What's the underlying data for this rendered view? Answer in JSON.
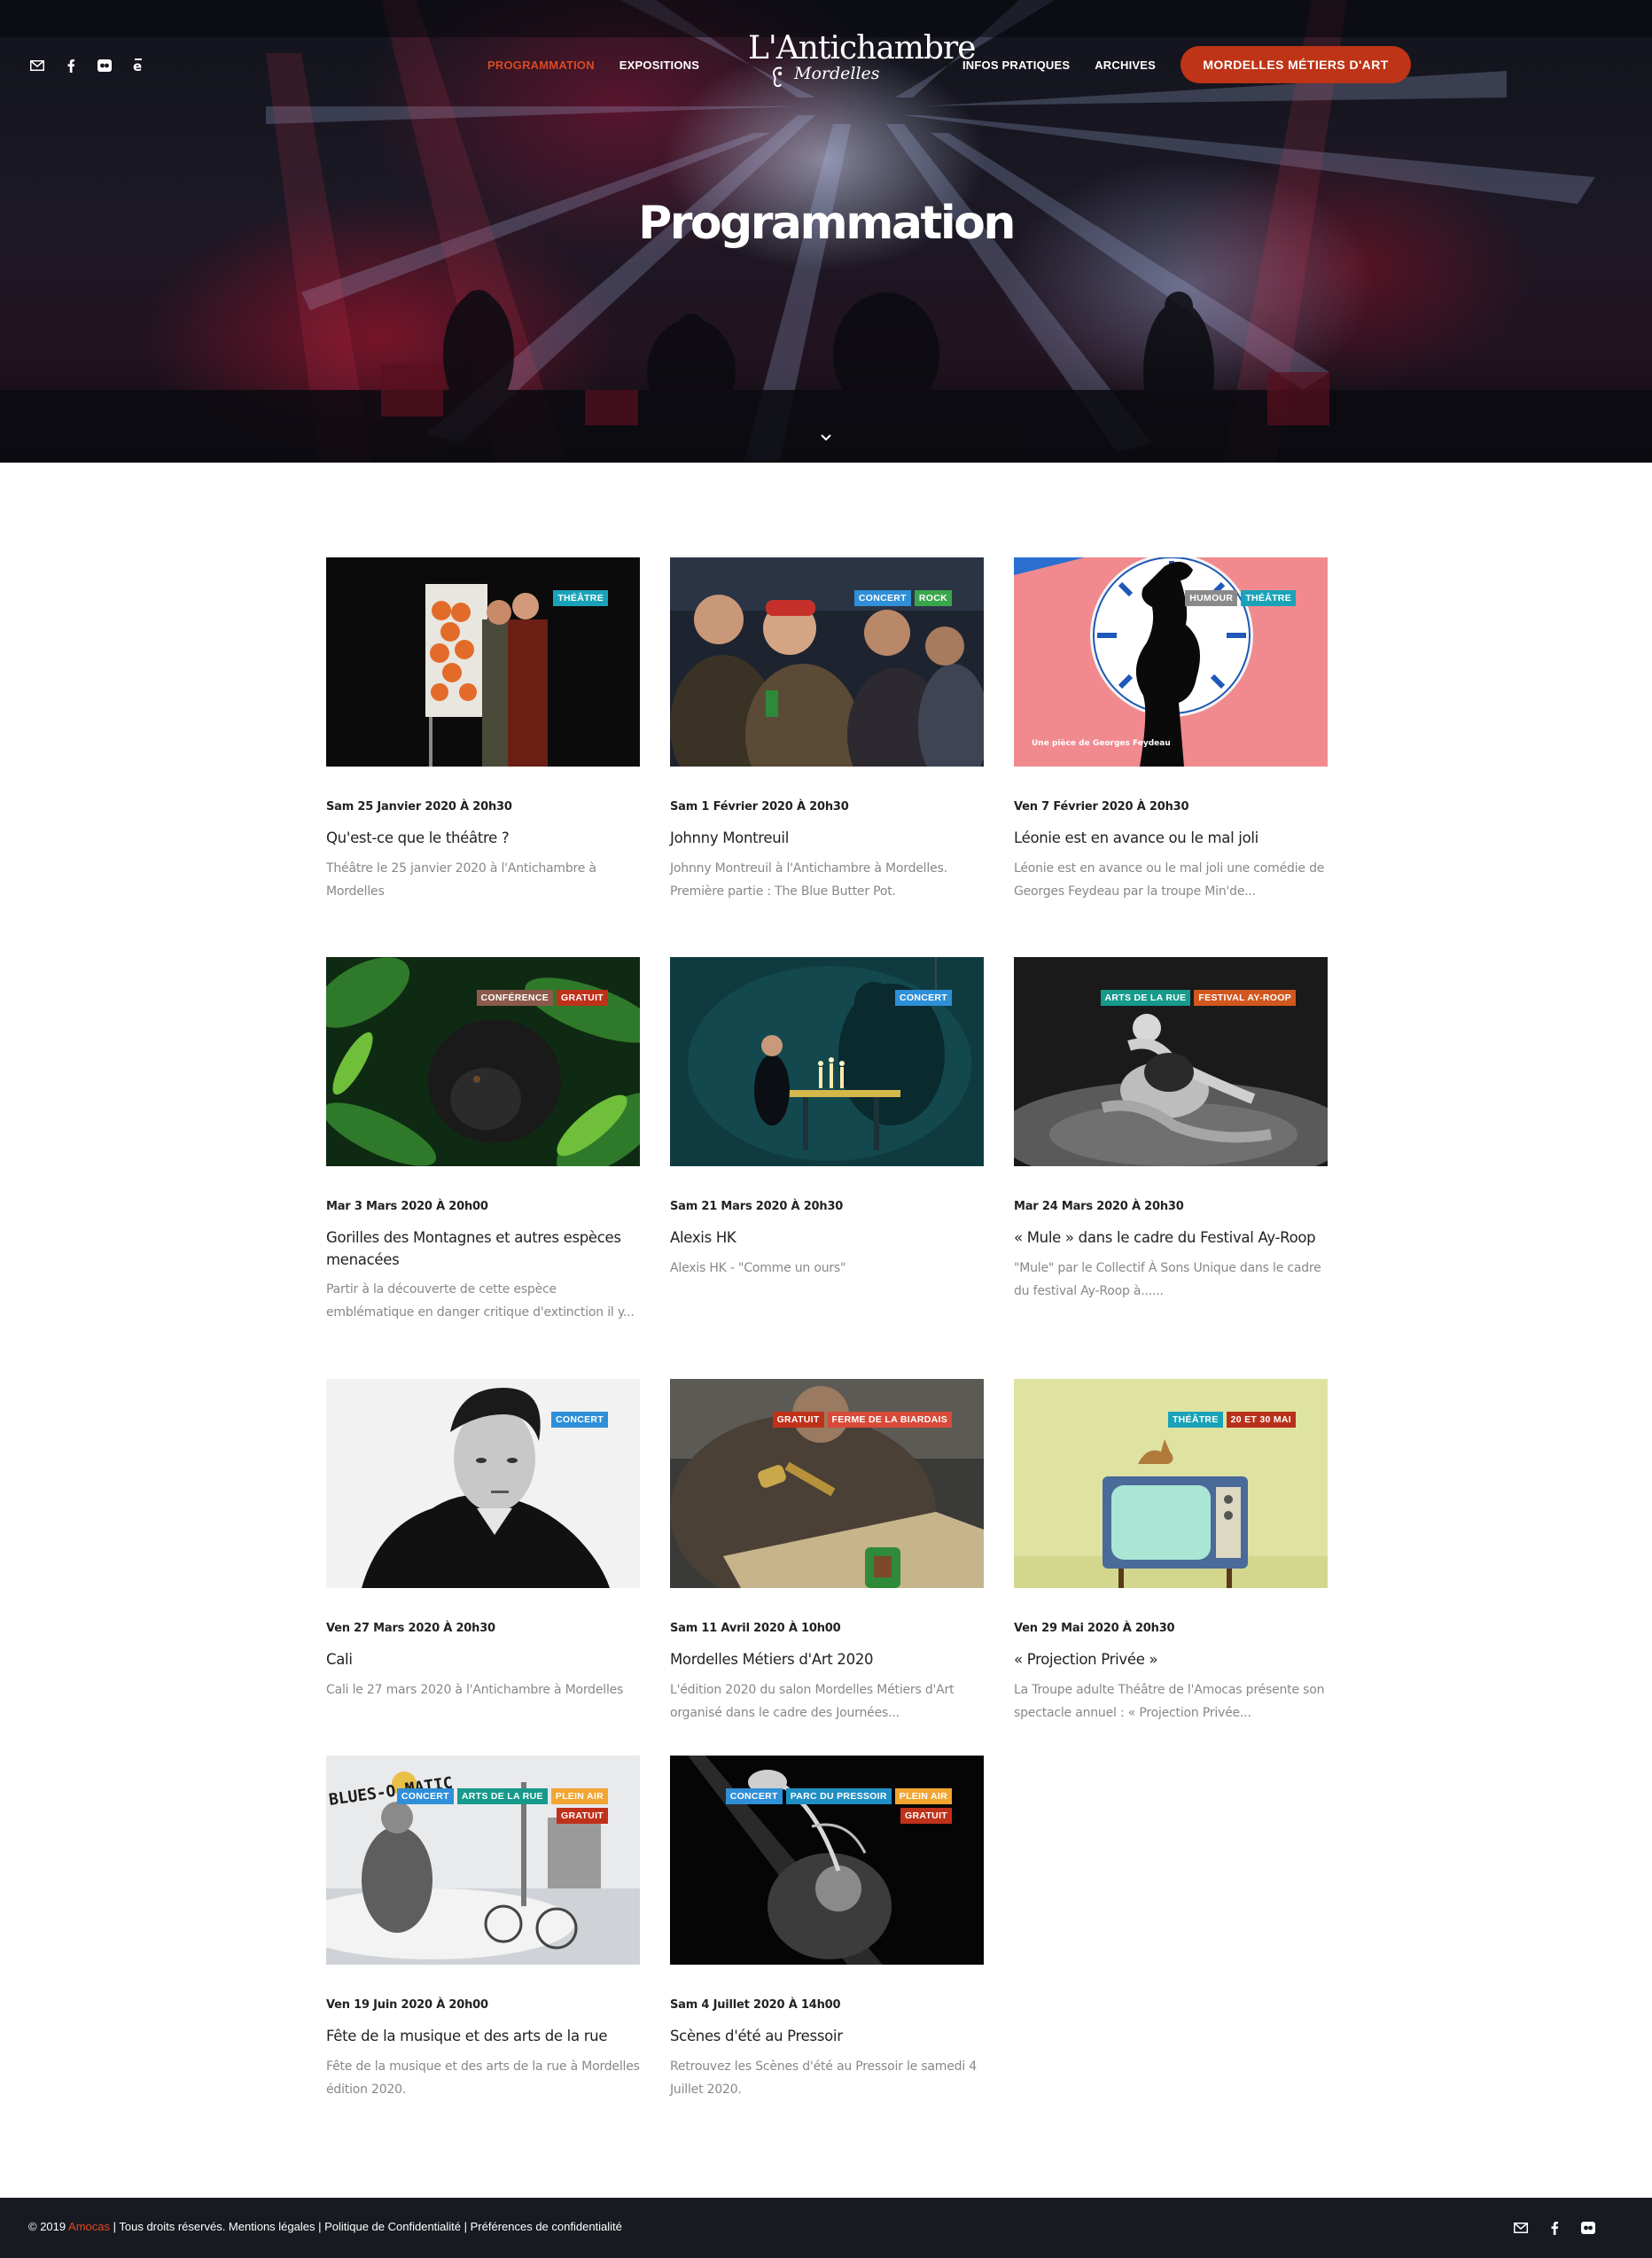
{
  "site": {
    "logo_main": "L'Antichambre",
    "logo_sub": "Mordelles"
  },
  "nav": {
    "left": [
      {
        "label": "PROGRAMMATION",
        "active": true
      },
      {
        "label": "EXPOSITIONS",
        "active": false
      }
    ],
    "right": [
      {
        "label": "INFOS PRATIQUES"
      },
      {
        "label": "ARCHIVES"
      }
    ],
    "cta_label": "MORDELLES MÉTIERS D'ART"
  },
  "social_icons": [
    "mail-icon",
    "facebook-icon",
    "flickr-icon",
    "e-icon"
  ],
  "hero": {
    "title": "Programmation"
  },
  "tag_colors": {
    "THÉÂTRE": "#1aa3b8",
    "CONCERT": "#2f8fd8",
    "ROCK": "#3aa64c",
    "HUMOUR": "#8a8a8a",
    "CONFÉRENCE": "#8b5a4a",
    "GRATUIT": "#c0311a",
    "ARTS DE LA RUE": "#169a8c",
    "FESTIVAL AY-ROOP": "#d2571f",
    "FERME DE LA BIARDAIS": "#d84a3a",
    "20 ET 30 MAI": "#b8321b",
    "PLEIN AIR": "#f2a531",
    "PARC DU PRESSOIR": "#1f8fc4"
  },
  "events": [
    {
      "date": "Sam 25 Janvier 2020 À 20h30",
      "title": "Qu'est-ce que le théâtre ?",
      "excerpt": "Théâtre le 25 janvier 2020 à l'Antichambre à Mordelles",
      "tags": [
        "THÉÂTRE"
      ]
    },
    {
      "date": "Sam 1 Février 2020 À 20h30",
      "title": "Johnny Montreuil",
      "excerpt": "Johnny Montreuil à l'Antichambre à Mordelles. Première partie : The Blue Butter Pot.",
      "tags": [
        "CONCERT",
        "ROCK"
      ]
    },
    {
      "date": "Ven 7 Février 2020 À 20h30",
      "title": "Léonie est en avance ou le mal joli",
      "excerpt": "Léonie est en avance ou le mal joli une comédie de Georges Feydeau par la troupe Min'de...",
      "tags": [
        "HUMOUR",
        "THÉÂTRE"
      ],
      "image_text": "Une pièce de Georges Feydeau"
    },
    {
      "date": "Mar 3 Mars 2020 À 20h00",
      "title": "Gorilles des Montagnes et autres espèces menacées",
      "excerpt": "Partir à la découverte de cette espèce emblématique en danger critique d'extinction il y...",
      "tags": [
        "CONFÉRENCE",
        "GRATUIT"
      ]
    },
    {
      "date": "Sam 21 Mars 2020 À 20h30",
      "title": "Alexis HK",
      "excerpt": "Alexis HK - \"Comme un ours\"",
      "tags": [
        "CONCERT"
      ]
    },
    {
      "date": "Mar 24 Mars 2020 À 20h30",
      "title": "« Mule » dans le cadre du Festival Ay-Roop",
      "excerpt": "\"Mule\" par le Collectif À Sons Unique dans le cadre du festival Ay-Roop à......",
      "tags": [
        "ARTS DE LA RUE",
        "FESTIVAL AY-ROOP"
      ]
    },
    {
      "date": "Ven 27 Mars 2020 À 20h30",
      "title": "Cali",
      "excerpt": "Cali le 27 mars 2020 à l'Antichambre à Mordelles",
      "tags": [
        "CONCERT"
      ]
    },
    {
      "date": "Sam 11 Avril 2020 À 10h00",
      "title": "Mordelles Métiers d'Art 2020",
      "excerpt": "L'édition 2020 du salon Mordelles Métiers d'Art organisé dans le cadre des Journées...",
      "tags": [
        "GRATUIT",
        "FERME DE LA BIARDAIS"
      ]
    },
    {
      "date": "Ven 29 Mai 2020 À 20h30",
      "title": "« Projection Privée »",
      "excerpt": "La Troupe adulte Théâtre de l'Amocas présente son spectacle annuel : « Projection Privée...",
      "tags": [
        "THÉÂTRE",
        "20 ET 30 MAI"
      ]
    },
    {
      "date": "Ven 19 Juin 2020 À 20h00",
      "title": "Fête de la musique et des arts de la rue",
      "excerpt": "Fête de la musique et des arts de la rue à Mordelles édition 2020.",
      "tags": [
        "CONCERT",
        "ARTS DE LA RUE",
        "PLEIN AIR",
        "GRATUIT"
      ],
      "image_text": "BLUES-O-MATIC"
    },
    {
      "date": "Sam 4 Juillet 2020 À 14h00",
      "title": "Scènes d'été au Pressoir",
      "excerpt": "Retrouvez les Scènes d'été au Pressoir le samedi 4 Juillet 2020.",
      "tags": [
        "CONCERT",
        "PARC DU PRESSOIR",
        "PLEIN AIR",
        "GRATUIT"
      ]
    }
  ],
  "footer": {
    "copyright_prefix": "© 2019",
    "brand": "Amocas",
    "rest": "| Tous droits réservés. Mentions légales | Politique de Confidentialité | Préférences de confidentialité"
  }
}
